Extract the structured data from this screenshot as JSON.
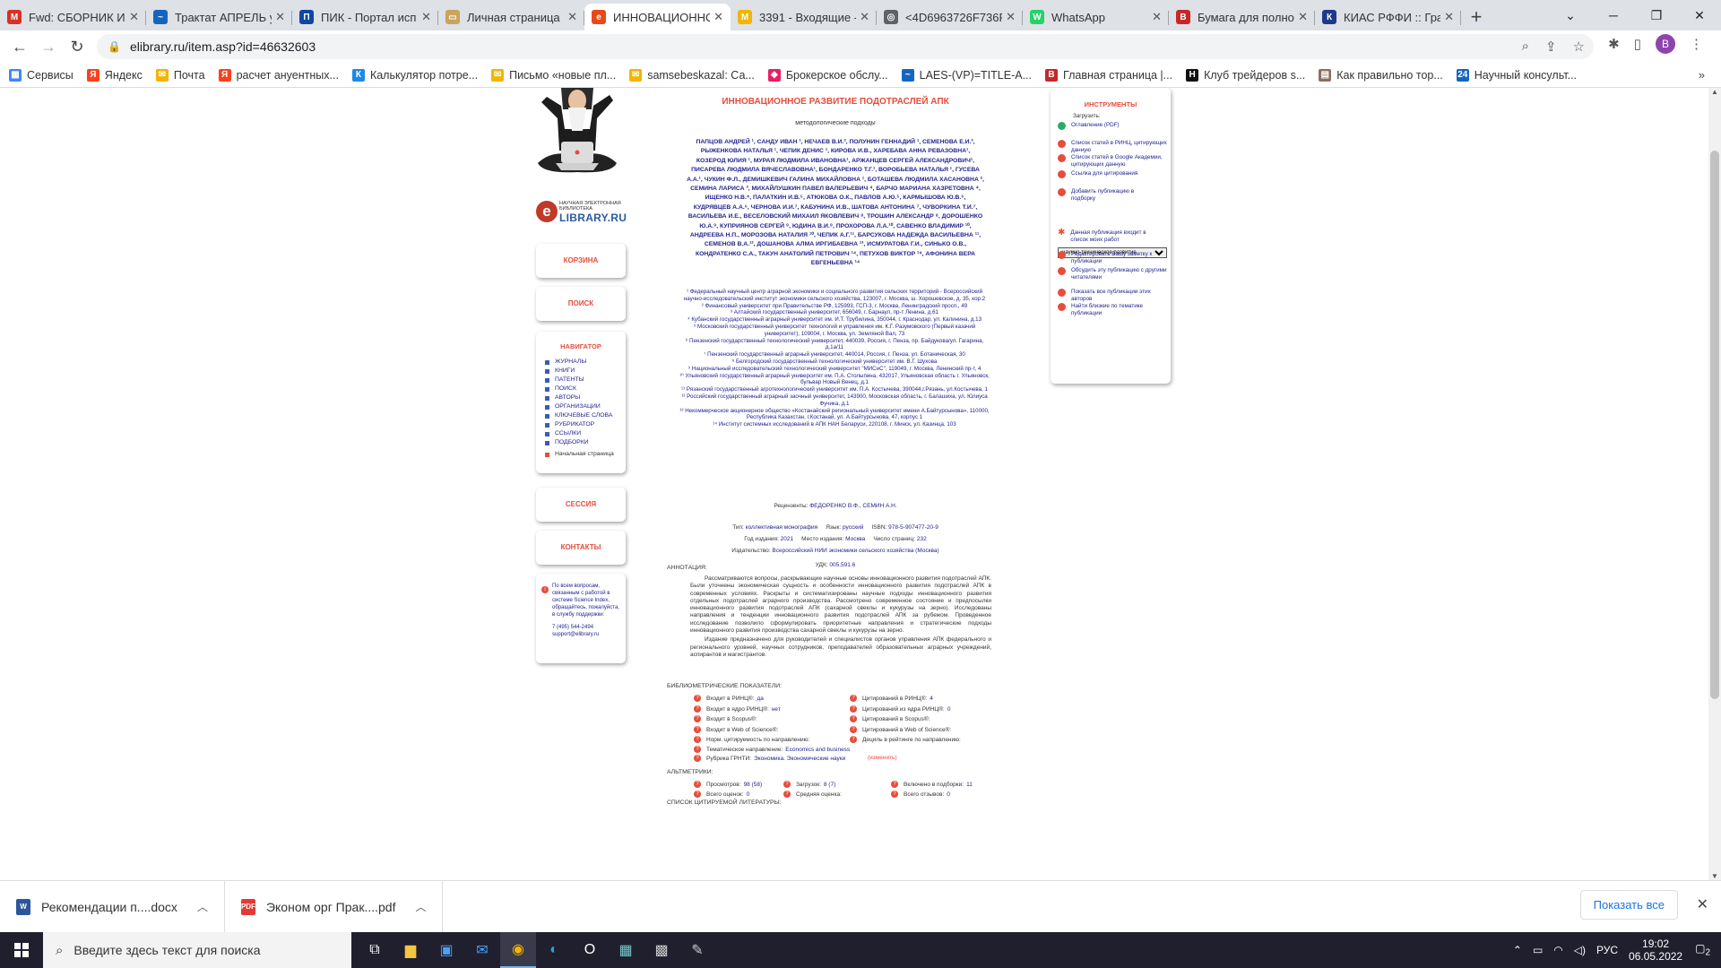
{
  "browser": {
    "tabs": [
      {
        "title": "Fwd: СБОРНИК И",
        "color": "#d93025",
        "glyph": "M"
      },
      {
        "title": "Трактат АПРЕЛЬ у",
        "color": "#1565c0",
        "glyph": "~"
      },
      {
        "title": "ПИК - Портал исп",
        "color": "#0d47a1",
        "glyph": "П"
      },
      {
        "title": "Личная страница",
        "color": "#c9a45c",
        "glyph": "▭"
      },
      {
        "title": "ИННОВАЦИОННС",
        "color": "#e64a19",
        "glyph": "e",
        "active": true
      },
      {
        "title": "3391 - Входящие -",
        "color": "#f4b400",
        "glyph": "M"
      },
      {
        "title": "<4D6963726F736F",
        "color": "#5f6368",
        "glyph": "◎"
      },
      {
        "title": "WhatsApp",
        "color": "#25d366",
        "glyph": "W"
      },
      {
        "title": "Бумага для полно",
        "color": "#c62828",
        "glyph": "B"
      },
      {
        "title": "КИАС РФФИ :: Гра",
        "color": "#1e3a8a",
        "glyph": "К"
      }
    ],
    "url": "elibrary.ru/item.asp?id=46632603",
    "profile_initial": "B",
    "bookmarks": [
      {
        "label": "Сервисы",
        "color": "#4285f4",
        "glyph": "▦"
      },
      {
        "label": "Яндекс",
        "color": "#fc3f1d",
        "glyph": "Я"
      },
      {
        "label": "Почта",
        "color": "#f4b400",
        "glyph": "✉"
      },
      {
        "label": "расчет ануентных...",
        "color": "#fc3f1d",
        "glyph": "Я"
      },
      {
        "label": "Калькулятор потре...",
        "color": "#1e88e5",
        "glyph": "К"
      },
      {
        "label": "Письмо «новые пл...",
        "color": "#f4b400",
        "glyph": "✉"
      },
      {
        "label": "samsebeskazal: Са...",
        "color": "#f4b400",
        "glyph": "✉"
      },
      {
        "label": "Брокерское обслу...",
        "color": "#e91e63",
        "glyph": "◆"
      },
      {
        "label": "LAES-(VP)=TITLE-A...",
        "color": "#1565c0",
        "glyph": "~"
      },
      {
        "label": "Главная страница |...",
        "color": "#c62828",
        "glyph": "B"
      },
      {
        "label": "Клуб трейдеров s...",
        "color": "#111111",
        "glyph": "H"
      },
      {
        "label": "Как правильно тор...",
        "color": "#8d6e63",
        "glyph": "▤"
      },
      {
        "label": "Научный консульт...",
        "color": "#1565c0",
        "glyph": "24"
      }
    ]
  },
  "left": {
    "logo_small": "НАУЧНАЯ ЭЛЕКТРОННАЯ БИБЛИОТЕКА",
    "logo_big": "LIBRARY.RU",
    "cart": "КОРЗИНА",
    "search": "ПОИСК",
    "navigator_title": "НАВИГАТОР",
    "nav": [
      "ЖУРНАЛЫ",
      "КНИГИ",
      "ПАТЕНТЫ",
      "ПОИСК",
      "АВТОРЫ",
      "ОРГАНИЗАЦИИ",
      "КЛЮЧЕВЫЕ СЛОВА",
      "РУБРИКАТОР",
      "ССЫЛКИ",
      "ПОДБОРКИ"
    ],
    "home": "Начальная страница",
    "session": "СЕССИЯ",
    "contacts": "КОНТАКТЫ",
    "info_text": "По всем вопросам, связанным с работой в системе Science Index, обращайтесь, пожалуйста, в службу поддержки:",
    "info_phone": "7 (495) 544-2494",
    "info_email": "support@elibrary.ru"
  },
  "main": {
    "title": "ИННОВАЦИОННОЕ РАЗВИТИЕ ПОДОТРАСЛЕЙ АПК",
    "subtitle": "методологические подходы",
    "authors": "ПАПЦОВ АНДРЕЙ ¹, САНДУ ИВАН ¹, НЕЧАЕВ В.И.², ПОЛУНИН ГЕННАДИЙ ¹, СЕМЕНОВА Е.И.³, РЫЖЕНКОВА НАТАЛЬЯ ¹, ЧЕПИК ДЕНИС ¹, КИРОВА И.В., ХАРЕБАВА АННА РЕВАЗОВНА¹, КОЗЕРОД ЮЛИЯ ¹, МУРАЯ ЛЮДМИЛА ИВАНОВНА¹, АРЖАНЦЕВ СЕРГЕЙ АЛЕКСАНДРОВИЧ¹, ПИСАРЕВА ЛЮДМИЛА ВЯЧЕСЛАВОВНА¹, БОНДАРЕНКО Т.Г.¹, ВОРОБЬЕВА НАТАЛЬЯ ¹, ГУСЕВА А.А.¹, ЧУКИН Ф.Л., ДЕМИШКЕВИЧ ГАЛИНА МИХАЙЛОВНА ¹, БОТАШЕВА ЛЮДМИЛА ХАСАНОВНА ², СЕМИНА ЛАРИСА ³, МИХАЙЛУШКИН ПАВЕЛ ВАЛЕРЬЕВИЧ ⁴, БАРЧО МАРИАНА ХАЗРЕТОВНА ⁴, ИЩЕНКО Н.В.⁴, ПАЛАТКИН И.В.⁵, АТЮКОВА О.К., ПАВЛОВ А.Ю.⁵, КАРМЫШОВА Ю.В.⁶, КУДРЯВЦЕВ А.А.⁶, ЧЕРНОВА И.И.⁷, КАБУНИНА И.В., ШАТОВА АНТОНИНА ⁷, ЧУВОРКИНА Т.И.⁷, ВАСИЛЬЕВА И.Е., ВЕСЕЛОВСКИЙ МИХАИЛ ЯКОВЛЕВИЧ ⁸, ТРОШИН АЛЕКСАНДР ⁸, ДОРОШЕНКО Ю.А.⁹, КУПРИЯНОВ СЕРГЕЙ ⁹, ЮДИНА В.И.⁹, ПРОХОРОВА Л.А.¹⁰, САВЕНКО ВЛАДИМИР ¹⁰, АНДРЕЕВА Н.П., МОРОЗОВА НАТАЛИЯ ¹⁰, ЧЕПИК А.Г.¹¹, БАРСУКОВА НАДЕЖДА ВАСИЛЬЕВНА ¹¹, СЕМЕНОВ В.А.¹², ДОШАНОВА АЛМА ИРГИБАЕВНА ¹³, ИСМУРАТОВА Г.И., СИНЬКО О.В., КОНДРАТЕНКО С.А., ТАКУН АНАТОЛИЙ ПЕТРОВИЧ ¹⁴, ПЕТУХОВ ВИКТОР ¹⁴, АФОНИНА ВЕРА ЕВГЕНЬЕВНА ¹⁴",
    "affiliations": [
      "¹ Федеральный научный центр аграрной экономики и социального развития сельских территорий - Всероссийский научно-исследовательский институт экономики сельского хозяйства, 123007, г. Москва, ш. Хорошевское, д. 35, кор.2",
      "² Финансовый университет при Правительстве РФ, 125993, ГСП-3, г. Москва, Ленинградский просп., 49",
      "³ Алтайский государственный университет, 656049, г. Барнаул, пр-т Ленина, д.61",
      "⁴ Кубанский государственный аграрный университет им. И.Т. Трубилина, 350044, г. Краснодар, ул. Калинина, д.13",
      "⁵ Московский государственный университет технологий и управления им. К.Г. Разумовского (Первый казачий университет), 109004, г. Москва, ул. Земляной Вал, 73",
      "⁶ Пензенский государственный технологический университет, 440039, Россия, г. Пенза, пр. Байдукова/ул. Гагарина, д.1а/11",
      "⁷ Пензенский государственный аграрный университет, 440014, Россия, г. Пенза, ул. Ботаническая, 30",
      "⁸ Белгородский государственный технологический университет им. В.Г. Шухова",
      "⁹ Национальный исследовательский технологический университет \"МИСиС\", 119049, г. Москва, Ленинский пр-т, 4",
      "¹⁰ Ульяновский государственный аграрный университет им. П.А. Столыпина, 432017, Ульяновская область г. Ульяновск, бульвар Новый Венец, д.1",
      "¹¹ Рязанский государственный агротехнологический университет им. П.А. Костычева, 390044,г.Рязань, ул.Костычева, 1",
      "¹² Российский государственный аграрный заочный университет, 143900, Московская область, г. Балашиха, ул. Юлиуса Фучика, д.1",
      "¹³ Некоммерческое акционерное общество «Костанайский региональный университет имени А.Байтурсынова», 110000, Республика Казахстан, г.Костанай, ул. А.Байтурсынова, 47, корпус 1",
      "¹⁴ Институт системных исследований в АПК НАН Беларуси, 220108, г. Минск, ул. Казинца, 103"
    ],
    "reviewers_label": "Рецензенты:",
    "reviewers": "ФЕДОРЕНКО В.Ф., СЕМИН А.Н.",
    "type_label": "Тип:",
    "type": "коллективная монография",
    "lang_label": "Язык:",
    "lang": "русский",
    "isbn_label": "ISBN:",
    "isbn": "978-5-907477-20-9",
    "year_label": "Год издания:",
    "year": "2021",
    "place_label": "Место издания:",
    "place": "Москва",
    "pages_label": "Число страниц:",
    "pages": "232",
    "publisher_label": "Издательство:",
    "publisher": "Всероссийский НИИ экономики сельского хозяйства (Москва)",
    "udk_label": "УДК:",
    "udk": "005.591.6",
    "annotation_label": "АННОТАЦИЯ:",
    "annotation_p1": "Рассматриваются вопросы, раскрывающие научные основы инновационного развития подотраслей АПК. Были уточнены экономическая сущность и особенности инновационного развития подотраслей АПК в современных условиях. Раскрыты и систематизированы научные подходы инновационного развития отдельных подотраслей аграрного производства. Рассмотрено современное состояние и предпосылки инновационного развития подотраслей АПК (сахарной свеклы и кукурузы на зерно). Исследованы направления и тенденции инновационного развития подотраслей АПК за рубежом. Проведенное исследование позволило сформулировать приоритетные направления и стратегические подходы инновационного развития производства сахарной свеклы и кукурузы на зерно.",
    "annotation_p2": "Издание предназначено для руководителей и специалистов органов управления АПК федерального и регионального уровней, научных сотрудников, преподавателей образовательных аграрных учреждений, аспирантов и магистрантов.",
    "biblio_label": "БИБЛИОМЕТРИЧЕСКИЕ ПОКАЗАТЕЛИ:",
    "biblio_left": [
      {
        "label": "Входит в РИНЦ®:",
        "value": "да"
      },
      {
        "label": "Входит в ядро РИНЦ®:",
        "value": "нет"
      },
      {
        "label": "Входит в Scopus®:",
        "value": ""
      },
      {
        "label": "Входит в Web of Science®:",
        "value": ""
      },
      {
        "label": "Норм. цитируемость по направлению:",
        "value": ""
      },
      {
        "label": "Тематическое направление:",
        "value": "Economics and business"
      },
      {
        "label": "Рубрика ГРНТИ:",
        "value": "Экономика. Экономические науки"
      }
    ],
    "biblio_change": "(изменить)",
    "biblio_right": [
      {
        "label": "Цитирований в РИНЦ®:",
        "value": "4"
      },
      {
        "label": "Цитирований из ядра РИНЦ®:",
        "value": "0"
      },
      {
        "label": "Цитирований в Scopus®:",
        "value": ""
      },
      {
        "label": "Цитирований в Web of Science®:",
        "value": ""
      },
      {
        "label": "Дециль в рейтинге по направлению:",
        "value": ""
      }
    ],
    "altmetrics_label": "АЛЬТМЕТРИКИ:",
    "alt": [
      {
        "label": "Просмотров:",
        "value": "98 (58)"
      },
      {
        "label": "Загрузок:",
        "value": "8 (7)"
      },
      {
        "label": "Включено в подборки:",
        "value": "11"
      },
      {
        "label": "Всего оценок:",
        "value": "0"
      },
      {
        "label": "Средняя оценка:",
        "value": ""
      },
      {
        "label": "Всего отзывов:",
        "value": "0"
      }
    ],
    "refs_label": "СПИСОК ЦИТИРУЕМОЙ ЛИТЕРАТУРЫ:"
  },
  "tools": {
    "title": "ИНСТРУМЕНТЫ",
    "download_label": "Загрузить:",
    "toc": "Оглавление (PDF)",
    "items": [
      "Список статей в РИНЦ, цитирующих данную",
      "Список статей в Google Академии, цитирующих данную",
      "Ссылка для цитирования",
      "Добавить публикацию в подборку"
    ],
    "select_value": "научно-техническое развитие",
    "my_list": "Данная публикация входит в список моих работ",
    "items2": [
      "Редактировать Вашу заметку к публикации",
      "Обсудить эту публикацию с другими читателями",
      "Показать все публикации этих авторов",
      "Найти близкие по тематике публикации"
    ]
  },
  "downloads": [
    {
      "name": "Рекомендации п....docx",
      "color": "#2b579a",
      "glyph": "W"
    },
    {
      "name": "Эконом орг Прак....pdf",
      "color": "#e53935",
      "glyph": "PDF"
    }
  ],
  "downloads_show_all": "Показать все",
  "taskbar": {
    "search_placeholder": "Введите здесь текст для поиска",
    "lang": "РУС",
    "time": "19:02",
    "date": "06.05.2022",
    "notif": "2"
  }
}
